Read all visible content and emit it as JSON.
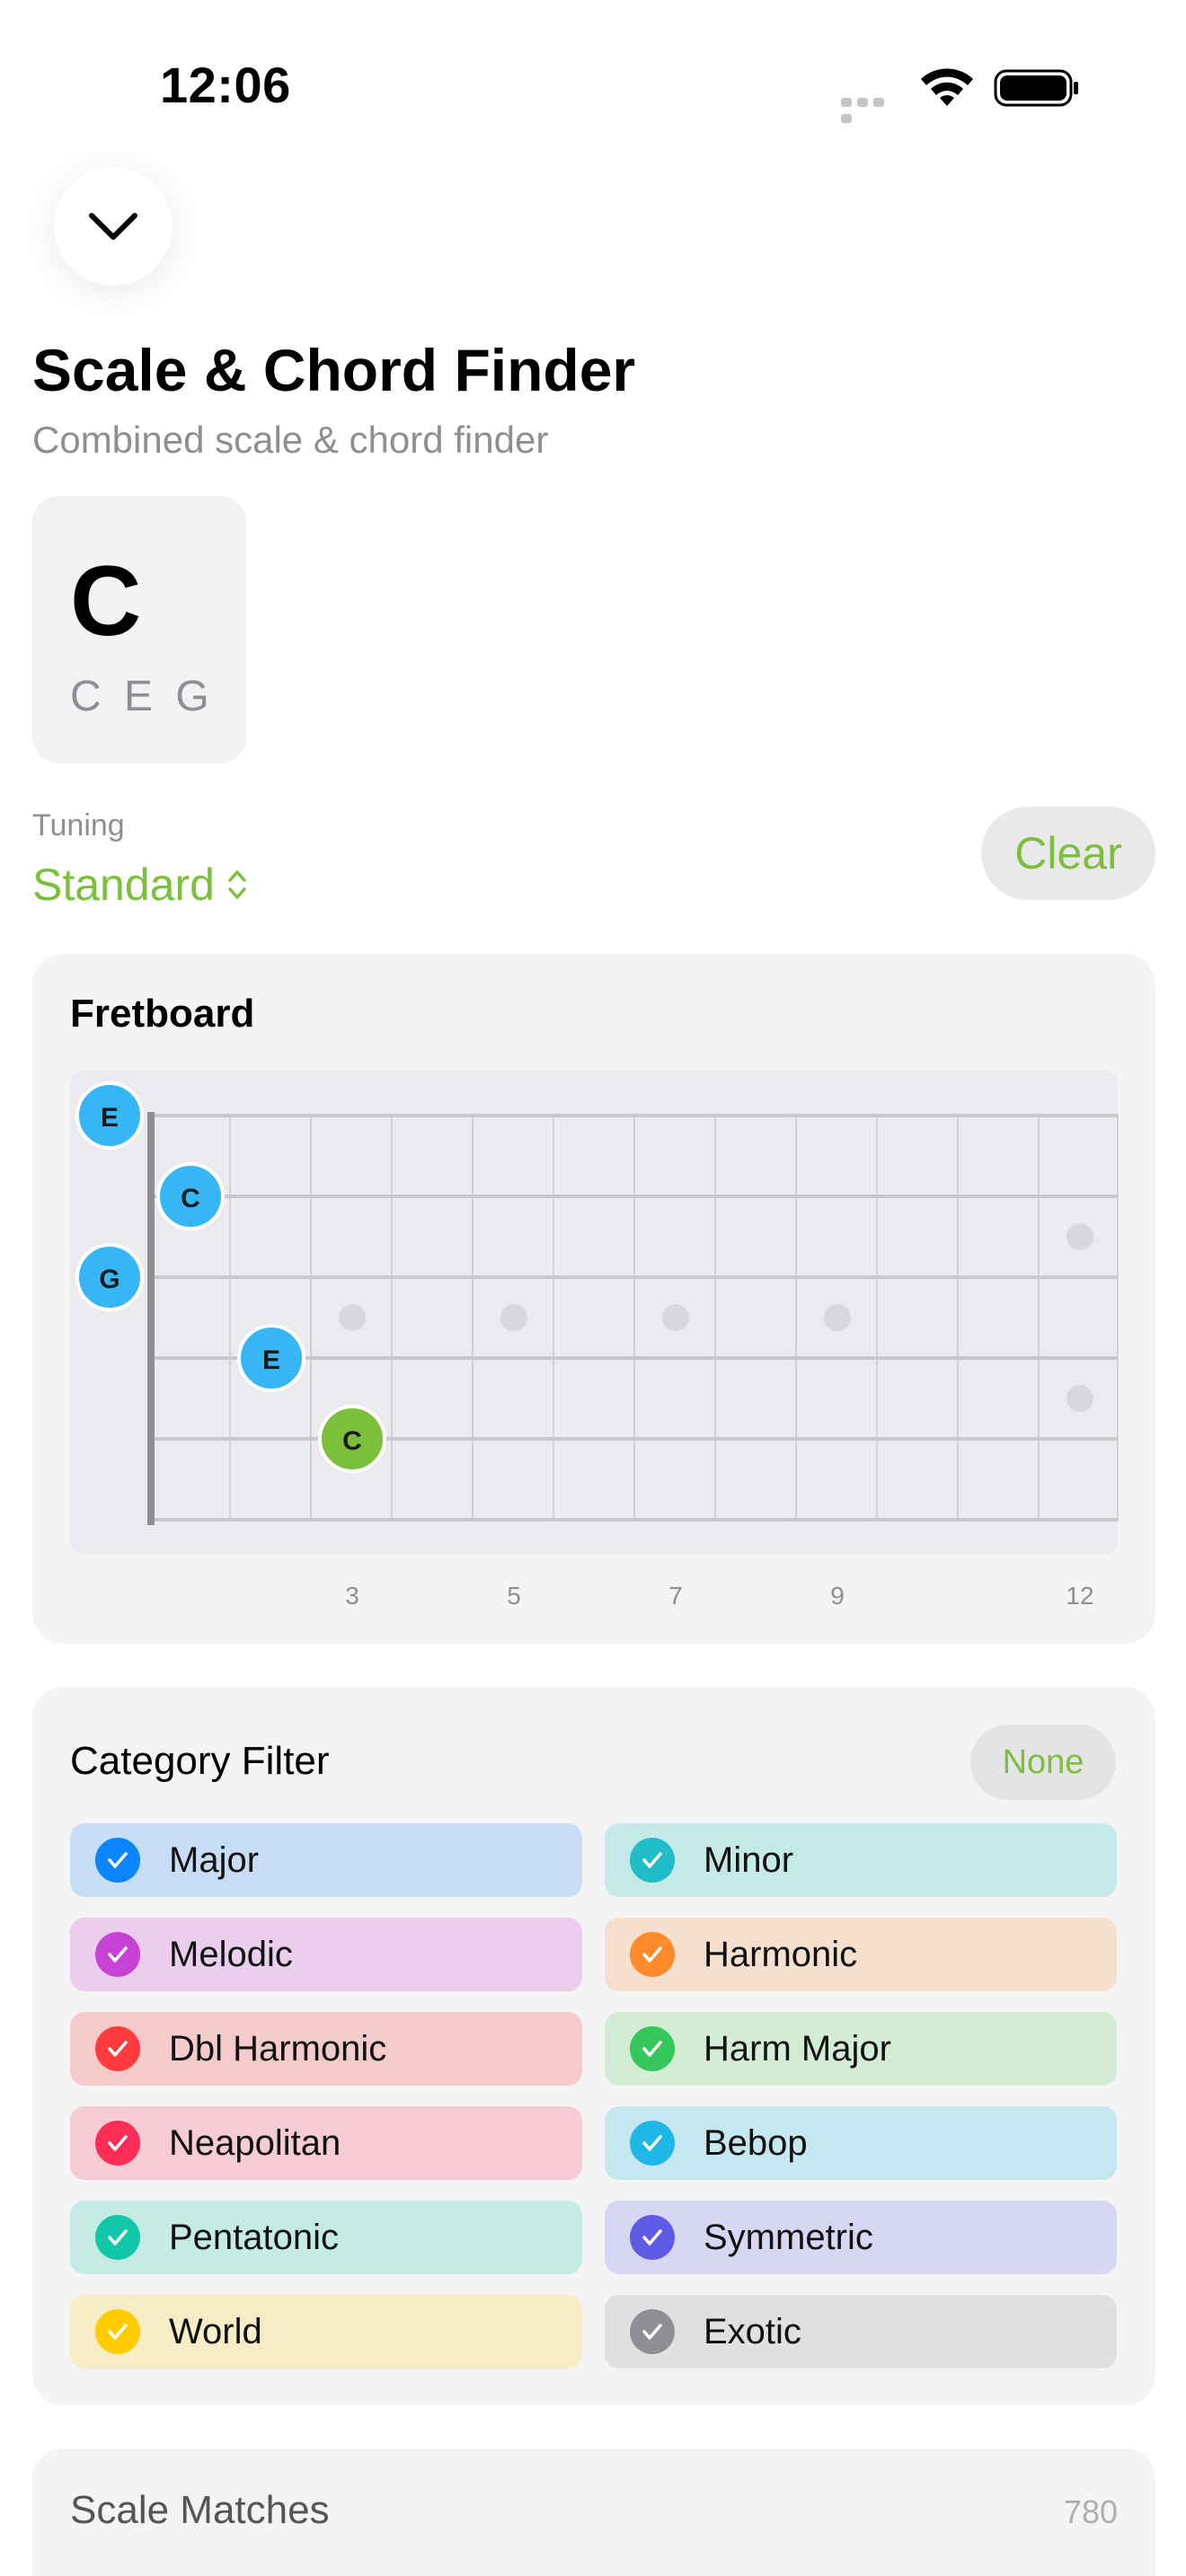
{
  "status_bar": {
    "time": "12:06"
  },
  "header": {
    "title": "Scale & Chord Finder",
    "subtitle": "Combined scale & chord finder"
  },
  "chord": {
    "name": "C",
    "notes": "C E G"
  },
  "tuning": {
    "label": "Tuning",
    "value": "Standard"
  },
  "clear_label": "Clear",
  "fretboard": {
    "title": "Fretboard",
    "fret_numbers": [
      "3",
      "5",
      "7",
      "9",
      "12"
    ],
    "notes": [
      {
        "label": "E",
        "color": "#36b6f5"
      },
      {
        "label": "C",
        "color": "#36b6f5"
      },
      {
        "label": "G",
        "color": "#36b6f5"
      },
      {
        "label": "E",
        "color": "#36b6f5"
      },
      {
        "label": "C",
        "color": "#7cbf3a"
      }
    ]
  },
  "category_filter": {
    "title": "Category Filter",
    "none_label": "None",
    "categories": [
      {
        "label": "Major",
        "color": "#0a84ff",
        "bg": "#c7ddf5"
      },
      {
        "label": "Minor",
        "color": "#20bcc8",
        "bg": "#c4e9e9"
      },
      {
        "label": "Melodic",
        "color": "#c643d6",
        "bg": "#ebcdee"
      },
      {
        "label": "Harmonic",
        "color": "#ff8a2a",
        "bg": "#f5dfcd"
      },
      {
        "label": "Dbl Harmonic",
        "color": "#ff3b40",
        "bg": "#f5cacb"
      },
      {
        "label": "Harm Major",
        "color": "#35c759",
        "bg": "#d3ecd6"
      },
      {
        "label": "Neapolitan",
        "color": "#ff2d55",
        "bg": "#f5ccd4"
      },
      {
        "label": "Bebop",
        "color": "#1fb6e8",
        "bg": "#c5e7ef"
      },
      {
        "label": "Pentatonic",
        "color": "#10c7a7",
        "bg": "#c4ece4"
      },
      {
        "label": "Symmetric",
        "color": "#5e5ce6",
        "bg": "#d7d6f3"
      },
      {
        "label": "World",
        "color": "#ffcc00",
        "bg": "#f6ecc5"
      },
      {
        "label": "Exotic",
        "color": "#8e8e93",
        "bg": "#e0e0e2"
      }
    ]
  },
  "scale_matches": {
    "title": "Scale Matches",
    "count": "780"
  }
}
